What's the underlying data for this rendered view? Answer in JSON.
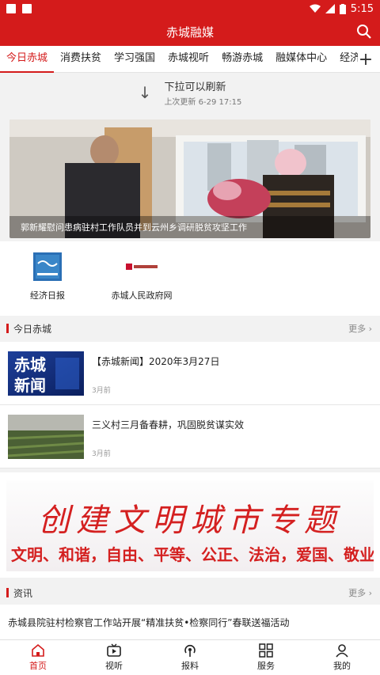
{
  "status_bar": {
    "time": "5:15"
  },
  "app": {
    "title": "赤城融媒"
  },
  "tabs": [
    {
      "label": "今日赤城"
    },
    {
      "label": "消费扶贫"
    },
    {
      "label": "学习强国"
    },
    {
      "label": "赤城视听"
    },
    {
      "label": "畅游赤城"
    },
    {
      "label": "融媒体中心"
    },
    {
      "label": "经济日"
    }
  ],
  "refresh": {
    "hint": "下拉可以刷新",
    "last_update": "上次更新 6-29 17:15"
  },
  "banner": {
    "caption": "郭新耀慰问患病驻村工作队员并到云州乡调研脱贫攻坚工作"
  },
  "sources": [
    {
      "name": "经济日报",
      "logo_text": "经济日报"
    },
    {
      "name": "赤城人民政府网",
      "logo_text": "赤城人民政府网"
    }
  ],
  "section_today": {
    "label": "今日赤城",
    "more": "更多"
  },
  "news": [
    {
      "headline": "【赤城新闻】2020年3月27日",
      "time": "3月前",
      "thumb_text": "赤城新闻"
    },
    {
      "headline": "三义村三月备春耕，巩固脱贫谋实效",
      "time": "3月前"
    }
  ],
  "promo": {
    "line1": "创建文明城市专题",
    "line2": "文明、和谐，自由、平等、公正、法治，爱国、敬业"
  },
  "section_info": {
    "label": "资讯",
    "more": "更多"
  },
  "info_news": [
    {
      "headline": "赤城县院驻村检察官工作站开展“精准扶贫•检察同行”春联送福活动"
    }
  ],
  "bottom_nav": [
    {
      "label": "首页",
      "icon": "home-icon"
    },
    {
      "label": "视听",
      "icon": "tv-icon"
    },
    {
      "label": "报料",
      "icon": "broadcast-icon"
    },
    {
      "label": "服务",
      "icon": "grid-icon"
    },
    {
      "label": "我的",
      "icon": "user-icon"
    }
  ],
  "colors": {
    "brand": "#d41b1b"
  }
}
